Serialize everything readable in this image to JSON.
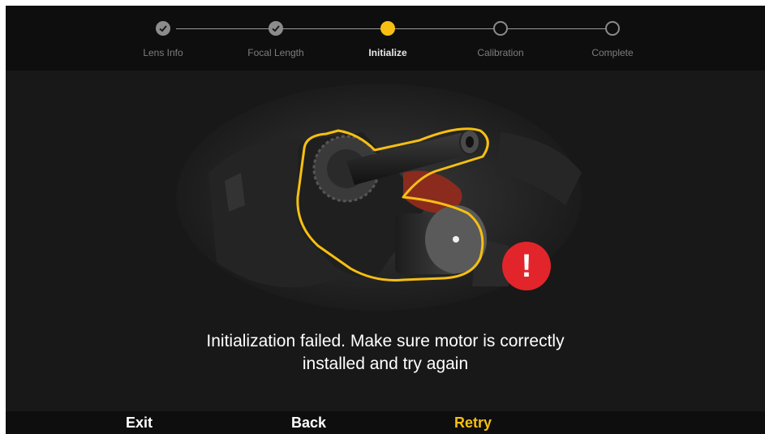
{
  "stepper": {
    "steps": [
      {
        "label": "Lens Info",
        "state": "done"
      },
      {
        "label": "Focal Length",
        "state": "done"
      },
      {
        "label": "Initialize",
        "state": "active"
      },
      {
        "label": "Calibration",
        "state": "pending"
      },
      {
        "label": "Complete",
        "state": "pending"
      }
    ]
  },
  "illustration": {
    "subject": "motor-gear-icon",
    "highlight_color": "#f6bf12",
    "alert": {
      "symbol": "!",
      "color": "#e2252b"
    }
  },
  "message": {
    "line1": "Initialization failed. Make sure motor is correctly",
    "line2": "installed and try again"
  },
  "actions": {
    "exit_label": "Exit",
    "back_label": "Back",
    "retry_label": "Retry",
    "retry_color": "#f6bf12"
  }
}
